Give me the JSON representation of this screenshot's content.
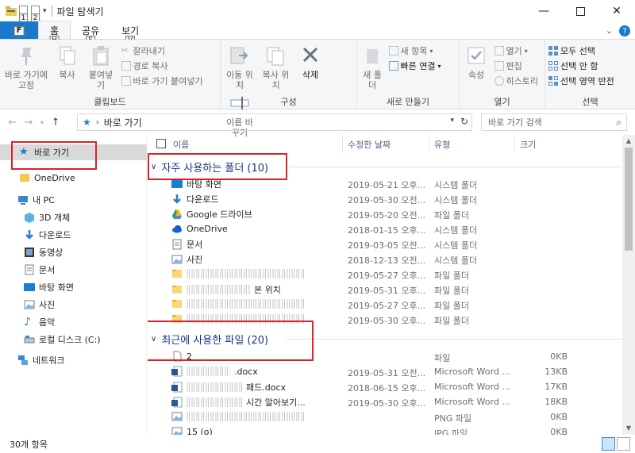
{
  "window": {
    "title": "파일 탐색기",
    "qat_keytips": [
      "1",
      "2"
    ]
  },
  "ribbon_tabs": {
    "file": "파일",
    "file_keytip": "F",
    "tabs": [
      {
        "label": "홈",
        "keytip": "H",
        "active": true
      },
      {
        "label": "공유",
        "keytip": "S",
        "active": false
      },
      {
        "label": "보기",
        "keytip": "V",
        "active": false
      }
    ]
  },
  "ribbon": {
    "clipboard": {
      "label": "클립보드",
      "pin": "바로 가기에 고정",
      "copy": "복사",
      "paste": "붙여넣기",
      "cut": "잘라내기",
      "copy_path": "경로 복사",
      "paste_shortcut": "바로 가기 붙여넣기"
    },
    "organize": {
      "label": "구성",
      "move_to": "이동 위치",
      "copy_to": "복사 위치",
      "delete": "삭제",
      "rename": "이름 바꾸기"
    },
    "new": {
      "label": "새로 만들기",
      "new_folder": "새 폴더",
      "new_item": "새 항목",
      "easy_access": "빠른 연결"
    },
    "open": {
      "label": "열기",
      "properties": "속성",
      "open": "열기",
      "edit": "편집",
      "history": "히스토리"
    },
    "select": {
      "label": "선택",
      "select_all": "모두 선택",
      "select_none": "선택 안 함",
      "invert": "선택 영역 반전"
    }
  },
  "address": {
    "path": "바로 가기",
    "search_placeholder": "바로 가기 검색"
  },
  "nav_pane": {
    "quick_access": "바로 가기",
    "onedrive": "OneDrive",
    "this_pc": "내 PC",
    "items": [
      "3D 개체",
      "다운로드",
      "동영상",
      "문서",
      "바탕 화면",
      "사진",
      "음악",
      "로컬 디스크 (C:)"
    ],
    "network": "네트워크"
  },
  "columns": {
    "name": "이름",
    "date": "수정한 날짜",
    "type": "유형",
    "size": "크기"
  },
  "frequent": {
    "title": "자주 사용하는 폴더 (10)",
    "rows": [
      {
        "name": "바탕 화면",
        "date": "2019-05-21 오후...",
        "type": "시스템 폴더",
        "icon": "desktop"
      },
      {
        "name": "다운로드",
        "date": "2019-05-30 오전...",
        "type": "시스템 폴더",
        "icon": "download"
      },
      {
        "name": "Google 드라이브",
        "date": "2019-05-20 오전...",
        "type": "파일 폴더",
        "icon": "gdrive"
      },
      {
        "name": "OneDrive",
        "date": "2018-01-15 오후...",
        "type": "시스템 폴더",
        "icon": "onedrive"
      },
      {
        "name": "문서",
        "date": "2019-03-05 오전...",
        "type": "시스템 폴더",
        "icon": "docs"
      },
      {
        "name": "사진",
        "date": "2018-12-13 오전...",
        "type": "시스템 폴더",
        "icon": "pictures"
      },
      {
        "name": "",
        "date": "2019-05-27 오후...",
        "type": "파일 폴더",
        "icon": "folder"
      },
      {
        "name": "본 위치",
        "date": "2019-05-31 오후...",
        "type": "파일 폴더",
        "icon": "folder"
      },
      {
        "name": "",
        "date": "2019-05-27 오후...",
        "type": "파일 폴더",
        "icon": "folder"
      },
      {
        "name": "",
        "date": "2019-05-30 오후...",
        "type": "파일 폴더",
        "icon": "folder"
      }
    ]
  },
  "recent": {
    "title": "최근에 사용한 파일 (20)",
    "rows": [
      {
        "name": "2",
        "date": "",
        "type": "파일",
        "size": "0KB",
        "icon": "file"
      },
      {
        "name": ".docx",
        "date": "2019-05-31 오전...",
        "type": "Microsoft Word ...",
        "size": "13KB",
        "icon": "word"
      },
      {
        "name": "패드.docx",
        "date": "2018-06-15 오후...",
        "type": "Microsoft Word ...",
        "size": "17KB",
        "icon": "word"
      },
      {
        "name": "시간 알아보기...",
        "date": "2019-05-30 오후...",
        "type": "Microsoft Word ...",
        "size": "18KB",
        "icon": "word"
      },
      {
        "name": "",
        "date": "",
        "type": "PNG 파일",
        "size": "0KB",
        "icon": "image"
      },
      {
        "name": "15 (o)",
        "date": "",
        "type": "JPG 파일",
        "size": "0KB",
        "icon": "image"
      }
    ]
  },
  "status": {
    "count": "30개 항목"
  },
  "colors": {
    "file_tab": "#1979ca",
    "group_header": "#1e3287",
    "highlight_box": "#d9232a",
    "selected": "#d9d9d9"
  }
}
